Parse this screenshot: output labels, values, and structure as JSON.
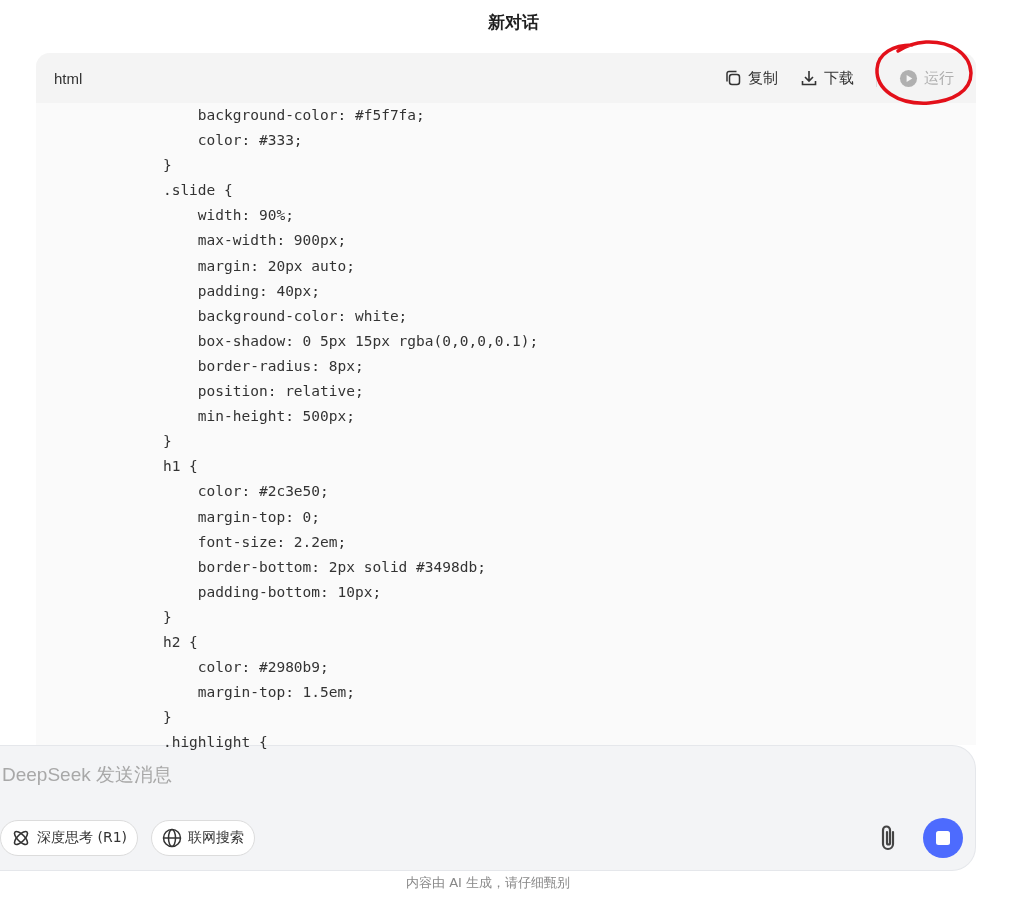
{
  "title": "新对话",
  "code_block": {
    "language": "html",
    "actions": [
      {
        "kind": "copy",
        "label": "复制",
        "disabled": false
      },
      {
        "kind": "download",
        "label": "下载",
        "disabled": false
      },
      {
        "kind": "run",
        "label": "运行",
        "disabled": true
      }
    ],
    "lines": [
      "        background-color: #f5f7fa;",
      "        color: #333;",
      "    }",
      "    .slide {",
      "        width: 90%;",
      "        max-width: 900px;",
      "        margin: 20px auto;",
      "        padding: 40px;",
      "        background-color: white;",
      "        box-shadow: 0 5px 15px rgba(0,0,0,0.1);",
      "        border-radius: 8px;",
      "        position: relative;",
      "        min-height: 500px;",
      "    }",
      "    h1 {",
      "        color: #2c3e50;",
      "        margin-top: 0;",
      "        font-size: 2.2em;",
      "        border-bottom: 2px solid #3498db;",
      "        padding-bottom: 10px;",
      "    }",
      "    h2 {",
      "        color: #2980b9;",
      "        margin-top: 1.5em;",
      "    }",
      "    .highlight {"
    ]
  },
  "composer": {
    "placeholder": "DeepSeek 发送消息",
    "toggles": [
      {
        "kind": "deepthink",
        "label": "深度思考 (R1)",
        "selected": false
      },
      {
        "kind": "search",
        "label": "联网搜索",
        "selected": false
      }
    ],
    "generating": true
  },
  "footer": "内容由 AI 生成，请仔细甄别"
}
